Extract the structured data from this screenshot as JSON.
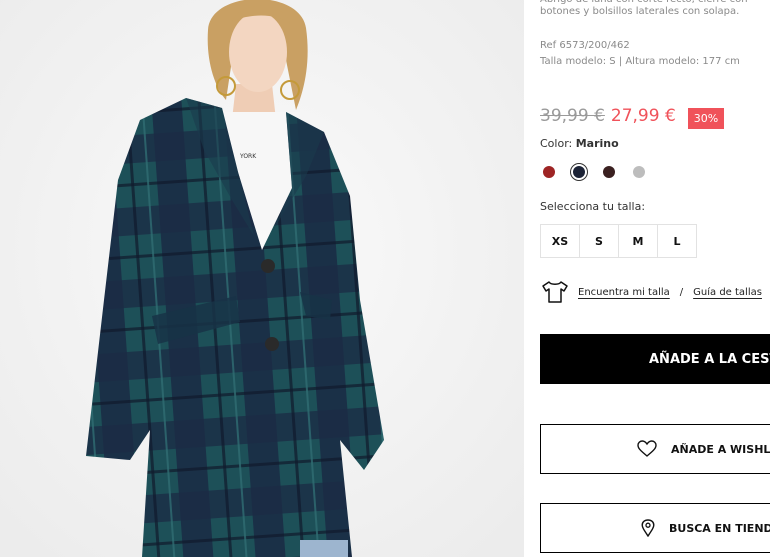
{
  "product": {
    "description": "Abrigo de lana con corte recto, cierre con botones y bolsillos laterales con solapa.",
    "ref": "Ref 6573/200/462",
    "model_info": "Talla modelo: S | Altura modelo: 177 cm"
  },
  "price": {
    "old": "39,99 €",
    "new": "27,99 €",
    "discount": "30%"
  },
  "color": {
    "label": "Color:",
    "selected": "Marino",
    "swatches": [
      {
        "name": "red",
        "hex": "#9e2424",
        "selected": false
      },
      {
        "name": "navy",
        "hex": "#1c2336",
        "selected": true
      },
      {
        "name": "burgundy",
        "hex": "#3a2020",
        "selected": false
      },
      {
        "name": "grey",
        "hex": "#bdbdbd",
        "selected": false
      }
    ]
  },
  "size": {
    "label": "Selecciona tu talla:",
    "options": [
      "XS",
      "S",
      "M",
      "L"
    ]
  },
  "fit": {
    "find_size": "Encuentra mi talla",
    "separator": "/",
    "size_guide": "Guía de tallas"
  },
  "actions": {
    "add_to_cart": "AÑADE A LA CESTA",
    "add_to_wishlist": "AÑADE A WISHLIST",
    "find_in_store": "BUSCA EN TIENDA"
  },
  "colors": {
    "sale": "#f0525a",
    "primary_button": "#000000"
  },
  "icons": {
    "fit": "tshirt-icon",
    "wishlist": "heart-icon",
    "store": "location-pin-icon"
  }
}
